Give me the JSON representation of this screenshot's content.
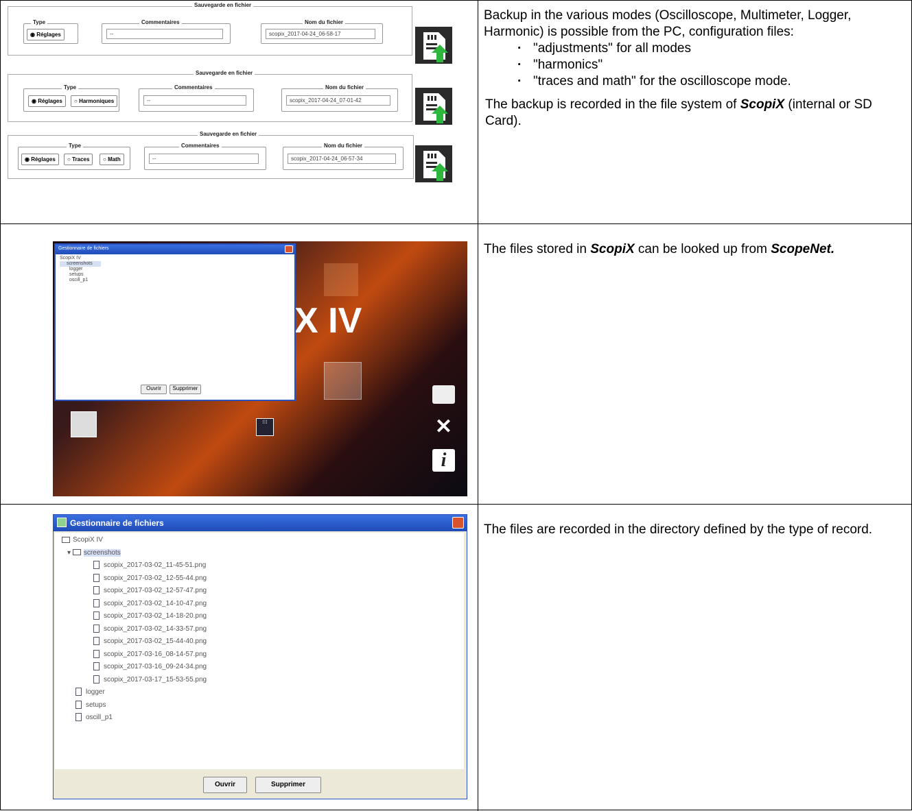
{
  "row1": {
    "save_panels": [
      {
        "title": "Sauvegarde en fichier",
        "type_legend": "Type",
        "type_options": [
          "Réglages"
        ],
        "comment_legend": "Commentaires",
        "comment_value": "--",
        "filename_legend": "Nom du fichier",
        "filename_value": "scopix_2017-04-24_06-58-17"
      },
      {
        "title": "Sauvegarde en fichier",
        "type_legend": "Type",
        "type_options": [
          "Réglages",
          "Harmoniques"
        ],
        "comment_legend": "Commentaires",
        "comment_value": "--",
        "filename_legend": "Nom du fichier",
        "filename_value": "scopix_2017-04-24_07-01-42"
      },
      {
        "title": "Sauvegarde en fichier",
        "type_legend": "Type",
        "type_options": [
          "Réglages",
          "Traces",
          "Math"
        ],
        "comment_legend": "Commentaires",
        "comment_value": "--",
        "filename_legend": "Nom du fichier",
        "filename_value": "scopix_2017-04-24_06-57-34"
      }
    ],
    "text_intro": "Backup in the various modes (Oscilloscope, Multimeter, Logger, Harmonic) is possible from the PC, configuration files:",
    "bullets": [
      "\"adjustments\" for all modes",
      "\"harmonics\"",
      "\"traces and math\" for the oscilloscope mode."
    ],
    "text_outro_pre": "The backup is recorded in the file system of ",
    "text_outro_brand": "ScopiX",
    "text_outro_post": " (internal or SD Card)."
  },
  "row2": {
    "window_title": "Gestionnaire de fichiers",
    "tree_root": "ScopiX IV",
    "tree_items": [
      "screenshots",
      "logger",
      "setups",
      "oscill_p1"
    ],
    "btn_open": "Ouvrir",
    "btn_delete": "Supprimer",
    "bg_label": "X IV",
    "text_pre": "The files stored in ",
    "text_brand1": "ScopiX",
    "text_mid": " can be looked up from ",
    "text_brand2": "ScopeNet."
  },
  "row3": {
    "window_title": "Gestionnaire de fichiers",
    "tree_root": "ScopiX IV",
    "tree_folder": "screenshots",
    "files": [
      "scopix_2017-03-02_11-45-51.png",
      "scopix_2017-03-02_12-55-44.png",
      "scopix_2017-03-02_12-57-47.png",
      "scopix_2017-03-02_14-10-47.png",
      "scopix_2017-03-02_14-18-20.png",
      "scopix_2017-03-02_14-33-57.png",
      "scopix_2017-03-02_15-44-40.png",
      "scopix_2017-03-16_08-14-57.png",
      "scopix_2017-03-16_09-24-34.png",
      "scopix_2017-03-17_15-53-55.png"
    ],
    "other_items": [
      "logger",
      "setups",
      "oscill_p1"
    ],
    "btn_open": "Ouvrir",
    "btn_delete": "Supprimer",
    "text": "The files are recorded in the directory defined by the type of record."
  },
  "colors": {
    "accent_green": "#2db83d",
    "xp_blue": "#2a52be"
  }
}
